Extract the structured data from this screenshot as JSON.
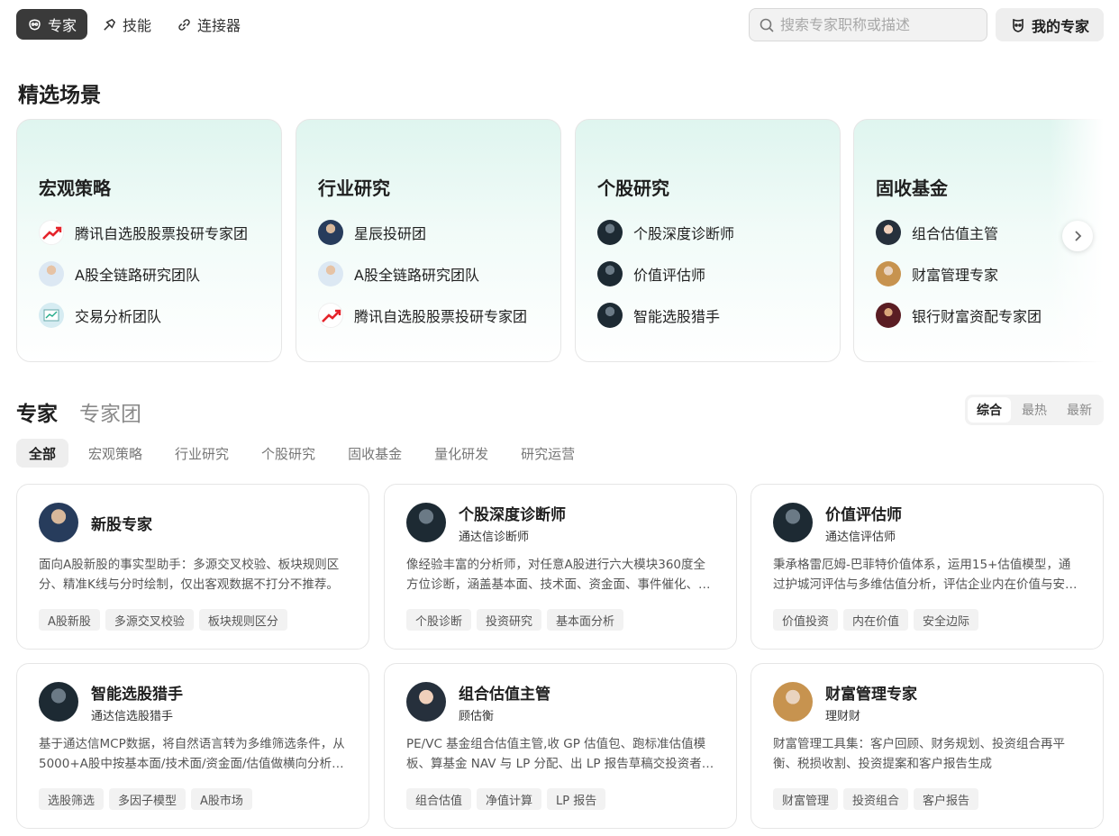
{
  "nav": {
    "tabs": [
      {
        "label": "专家",
        "icon": "expert-icon"
      },
      {
        "label": "技能",
        "icon": "skill-icon"
      },
      {
        "label": "连接器",
        "icon": "link-icon"
      }
    ],
    "search_placeholder": "搜索专家职称或描述",
    "my_experts": "我的专家"
  },
  "featured": {
    "title": "精选场景",
    "cards": [
      {
        "title": "宏观策略",
        "items": [
          {
            "label": "腾讯自选股股票投研专家团",
            "avatar": "tencent"
          },
          {
            "label": "A股全链路研究团队",
            "avatar": "light"
          },
          {
            "label": "交易分析团队",
            "avatar": "chart"
          }
        ]
      },
      {
        "title": "行业研究",
        "items": [
          {
            "label": "星辰投研团",
            "avatar": "navy"
          },
          {
            "label": "A股全链路研究团队",
            "avatar": "light"
          },
          {
            "label": "腾讯自选股股票投研专家团",
            "avatar": "tencent"
          }
        ]
      },
      {
        "title": "个股研究",
        "items": [
          {
            "label": "个股深度诊断师",
            "avatar": "dark"
          },
          {
            "label": "价值评估师",
            "avatar": "dark"
          },
          {
            "label": "智能选股猎手",
            "avatar": "dark"
          }
        ]
      },
      {
        "title": "固收基金",
        "items": [
          {
            "label": "组合估值主管",
            "avatar": "woman"
          },
          {
            "label": "财富管理专家",
            "avatar": "gold"
          },
          {
            "label": "银行财富资配专家团",
            "avatar": "maroon"
          }
        ]
      }
    ]
  },
  "experts_section": {
    "tabs": [
      "专家",
      "专家团"
    ],
    "sort": [
      "综合",
      "最热",
      "最新"
    ],
    "categories": [
      "全部",
      "宏观策略",
      "行业研究",
      "个股研究",
      "固收基金",
      "量化研发",
      "研究运营"
    ]
  },
  "experts": [
    {
      "name": "新股专家",
      "sub": "",
      "avatar": "navy",
      "desc": "面向A股新股的事实型助手：多源交叉校验、板块规则区分、精准K线与分时绘制，仅出客观数据不打分不推荐。",
      "tags": [
        "A股新股",
        "多源交叉校验",
        "板块规则区分"
      ]
    },
    {
      "name": "个股深度诊断师",
      "sub": "通达信诊断师",
      "avatar": "dark",
      "desc": "像经验丰富的分析师，对任意A股进行六大模块360度全方位诊断，涵盖基本面、技术面、资金面、事件催化、同业对比等维度。",
      "tags": [
        "个股诊断",
        "投资研究",
        "基本面分析"
      ]
    },
    {
      "name": "价值评估师",
      "sub": "通达信评估师",
      "avatar": "dark",
      "desc": "秉承格雷厄姆-巴菲特价值体系，运用15+估值模型，通过护城河评估与多维估值分析，评估企业内在价值与安全边际。",
      "tags": [
        "价值投资",
        "内在价值",
        "安全边际"
      ]
    },
    {
      "name": "智能选股猎手",
      "sub": "通达信选股猎手",
      "avatar": "dark",
      "desc": "基于通达信MCP数据，将自然语言转为多维筛选条件，从5000+A股中按基本面/技术面/资金面/估值做横向分析与排序。",
      "tags": [
        "选股筛选",
        "多因子模型",
        "A股市场"
      ]
    },
    {
      "name": "组合估值主管",
      "sub": "顾估衡",
      "avatar": "woman",
      "desc": "PE/VC 基金组合估值主管,收 GP 估值包、跑标准估值模板、算基金 NAV 与 LP 分配、出 LP 报告草稿交投资者关系。",
      "tags": [
        "组合估值",
        "净值计算",
        "LP 报告"
      ]
    },
    {
      "name": "财富管理专家",
      "sub": "理财财",
      "avatar": "gold",
      "desc": "财富管理工具集：客户回顾、财务规划、投资组合再平衡、税损收割、投资提案和客户报告生成",
      "tags": [
        "财富管理",
        "投资组合",
        "客户报告"
      ]
    }
  ]
}
